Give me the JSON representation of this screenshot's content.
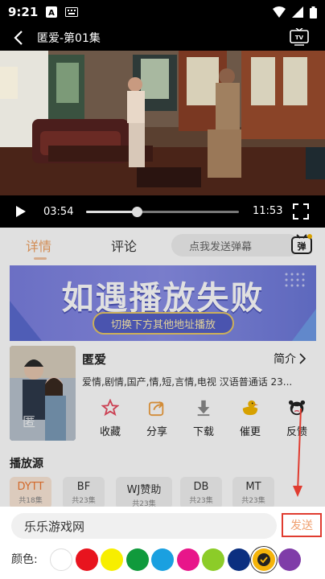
{
  "status_bar": {
    "time": "9:21"
  },
  "player": {
    "title": "匿爱-第01集",
    "current_time": "03:54",
    "duration": "11:53",
    "progress": 0.33
  },
  "tabs": {
    "details": "详情",
    "comments": "评论",
    "danmu_placeholder": "点我发送弹幕",
    "danmu_badge": "弹"
  },
  "banner": {
    "headline": "如遇播放失败",
    "subline": "切换下方其他地址播放"
  },
  "show": {
    "name": "匿爱",
    "intro_label": "简介",
    "tags": "爱情,剧情,国产,情,短,言情,电视 汉语普通话 23...",
    "actions": [
      {
        "label": "收藏",
        "icon": "star-icon",
        "color": "#e84a5f"
      },
      {
        "label": "分享",
        "icon": "share-icon",
        "color": "#f0a040"
      },
      {
        "label": "下载",
        "icon": "download-icon",
        "color": "#8a8a8a"
      },
      {
        "label": "催更",
        "icon": "duck-icon",
        "color": "#f5b800"
      },
      {
        "label": "反馈",
        "icon": "feedback-icon",
        "color": "#555555"
      }
    ]
  },
  "sources": {
    "title": "播放源",
    "items": [
      {
        "name": "DYTT",
        "count": "共18集",
        "active": true
      },
      {
        "name": "BF",
        "count": "共23集",
        "active": false
      },
      {
        "name": "WJ赞助",
        "count": "共23集",
        "active": false
      },
      {
        "name": "DB",
        "count": "共23集",
        "active": false
      },
      {
        "name": "MT",
        "count": "共23集",
        "active": false
      }
    ]
  },
  "composer": {
    "input_value": "乐乐游戏网",
    "send_label": "发送",
    "color_label": "颜色:",
    "colors": [
      "#ffffff",
      "#e8141e",
      "#f7ee00",
      "#109a3c",
      "#1aa0e0",
      "#e8168a",
      "#8ccc28",
      "#0b2f80",
      "#f5b40a",
      "#7f3ca8"
    ],
    "selected_color_index": 8
  }
}
